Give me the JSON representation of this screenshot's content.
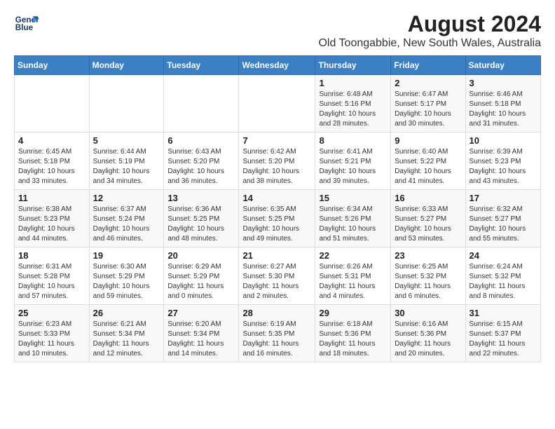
{
  "logo": {
    "line1": "General",
    "line2": "Blue"
  },
  "title": "August 2024",
  "subtitle": "Old Toongabbie, New South Wales, Australia",
  "weekdays": [
    "Sunday",
    "Monday",
    "Tuesday",
    "Wednesday",
    "Thursday",
    "Friday",
    "Saturday"
  ],
  "weeks": [
    [
      {
        "day": "",
        "sunrise": "",
        "sunset": "",
        "daylight": ""
      },
      {
        "day": "",
        "sunrise": "",
        "sunset": "",
        "daylight": ""
      },
      {
        "day": "",
        "sunrise": "",
        "sunset": "",
        "daylight": ""
      },
      {
        "day": "",
        "sunrise": "",
        "sunset": "",
        "daylight": ""
      },
      {
        "day": "1",
        "sunrise": "Sunrise: 6:48 AM",
        "sunset": "Sunset: 5:16 PM",
        "daylight": "Daylight: 10 hours and 28 minutes."
      },
      {
        "day": "2",
        "sunrise": "Sunrise: 6:47 AM",
        "sunset": "Sunset: 5:17 PM",
        "daylight": "Daylight: 10 hours and 30 minutes."
      },
      {
        "day": "3",
        "sunrise": "Sunrise: 6:46 AM",
        "sunset": "Sunset: 5:18 PM",
        "daylight": "Daylight: 10 hours and 31 minutes."
      }
    ],
    [
      {
        "day": "4",
        "sunrise": "Sunrise: 6:45 AM",
        "sunset": "Sunset: 5:18 PM",
        "daylight": "Daylight: 10 hours and 33 minutes."
      },
      {
        "day": "5",
        "sunrise": "Sunrise: 6:44 AM",
        "sunset": "Sunset: 5:19 PM",
        "daylight": "Daylight: 10 hours and 34 minutes."
      },
      {
        "day": "6",
        "sunrise": "Sunrise: 6:43 AM",
        "sunset": "Sunset: 5:20 PM",
        "daylight": "Daylight: 10 hours and 36 minutes."
      },
      {
        "day": "7",
        "sunrise": "Sunrise: 6:42 AM",
        "sunset": "Sunset: 5:20 PM",
        "daylight": "Daylight: 10 hours and 38 minutes."
      },
      {
        "day": "8",
        "sunrise": "Sunrise: 6:41 AM",
        "sunset": "Sunset: 5:21 PM",
        "daylight": "Daylight: 10 hours and 39 minutes."
      },
      {
        "day": "9",
        "sunrise": "Sunrise: 6:40 AM",
        "sunset": "Sunset: 5:22 PM",
        "daylight": "Daylight: 10 hours and 41 minutes."
      },
      {
        "day": "10",
        "sunrise": "Sunrise: 6:39 AM",
        "sunset": "Sunset: 5:23 PM",
        "daylight": "Daylight: 10 hours and 43 minutes."
      }
    ],
    [
      {
        "day": "11",
        "sunrise": "Sunrise: 6:38 AM",
        "sunset": "Sunset: 5:23 PM",
        "daylight": "Daylight: 10 hours and 44 minutes."
      },
      {
        "day": "12",
        "sunrise": "Sunrise: 6:37 AM",
        "sunset": "Sunset: 5:24 PM",
        "daylight": "Daylight: 10 hours and 46 minutes."
      },
      {
        "day": "13",
        "sunrise": "Sunrise: 6:36 AM",
        "sunset": "Sunset: 5:25 PM",
        "daylight": "Daylight: 10 hours and 48 minutes."
      },
      {
        "day": "14",
        "sunrise": "Sunrise: 6:35 AM",
        "sunset": "Sunset: 5:25 PM",
        "daylight": "Daylight: 10 hours and 49 minutes."
      },
      {
        "day": "15",
        "sunrise": "Sunrise: 6:34 AM",
        "sunset": "Sunset: 5:26 PM",
        "daylight": "Daylight: 10 hours and 51 minutes."
      },
      {
        "day": "16",
        "sunrise": "Sunrise: 6:33 AM",
        "sunset": "Sunset: 5:27 PM",
        "daylight": "Daylight: 10 hours and 53 minutes."
      },
      {
        "day": "17",
        "sunrise": "Sunrise: 6:32 AM",
        "sunset": "Sunset: 5:27 PM",
        "daylight": "Daylight: 10 hours and 55 minutes."
      }
    ],
    [
      {
        "day": "18",
        "sunrise": "Sunrise: 6:31 AM",
        "sunset": "Sunset: 5:28 PM",
        "daylight": "Daylight: 10 hours and 57 minutes."
      },
      {
        "day": "19",
        "sunrise": "Sunrise: 6:30 AM",
        "sunset": "Sunset: 5:29 PM",
        "daylight": "Daylight: 10 hours and 59 minutes."
      },
      {
        "day": "20",
        "sunrise": "Sunrise: 6:29 AM",
        "sunset": "Sunset: 5:29 PM",
        "daylight": "Daylight: 11 hours and 0 minutes."
      },
      {
        "day": "21",
        "sunrise": "Sunrise: 6:27 AM",
        "sunset": "Sunset: 5:30 PM",
        "daylight": "Daylight: 11 hours and 2 minutes."
      },
      {
        "day": "22",
        "sunrise": "Sunrise: 6:26 AM",
        "sunset": "Sunset: 5:31 PM",
        "daylight": "Daylight: 11 hours and 4 minutes."
      },
      {
        "day": "23",
        "sunrise": "Sunrise: 6:25 AM",
        "sunset": "Sunset: 5:32 PM",
        "daylight": "Daylight: 11 hours and 6 minutes."
      },
      {
        "day": "24",
        "sunrise": "Sunrise: 6:24 AM",
        "sunset": "Sunset: 5:32 PM",
        "daylight": "Daylight: 11 hours and 8 minutes."
      }
    ],
    [
      {
        "day": "25",
        "sunrise": "Sunrise: 6:23 AM",
        "sunset": "Sunset: 5:33 PM",
        "daylight": "Daylight: 11 hours and 10 minutes."
      },
      {
        "day": "26",
        "sunrise": "Sunrise: 6:21 AM",
        "sunset": "Sunset: 5:34 PM",
        "daylight": "Daylight: 11 hours and 12 minutes."
      },
      {
        "day": "27",
        "sunrise": "Sunrise: 6:20 AM",
        "sunset": "Sunset: 5:34 PM",
        "daylight": "Daylight: 11 hours and 14 minutes."
      },
      {
        "day": "28",
        "sunrise": "Sunrise: 6:19 AM",
        "sunset": "Sunset: 5:35 PM",
        "daylight": "Daylight: 11 hours and 16 minutes."
      },
      {
        "day": "29",
        "sunrise": "Sunrise: 6:18 AM",
        "sunset": "Sunset: 5:36 PM",
        "daylight": "Daylight: 11 hours and 18 minutes."
      },
      {
        "day": "30",
        "sunrise": "Sunrise: 6:16 AM",
        "sunset": "Sunset: 5:36 PM",
        "daylight": "Daylight: 11 hours and 20 minutes."
      },
      {
        "day": "31",
        "sunrise": "Sunrise: 6:15 AM",
        "sunset": "Sunset: 5:37 PM",
        "daylight": "Daylight: 11 hours and 22 minutes."
      }
    ]
  ]
}
